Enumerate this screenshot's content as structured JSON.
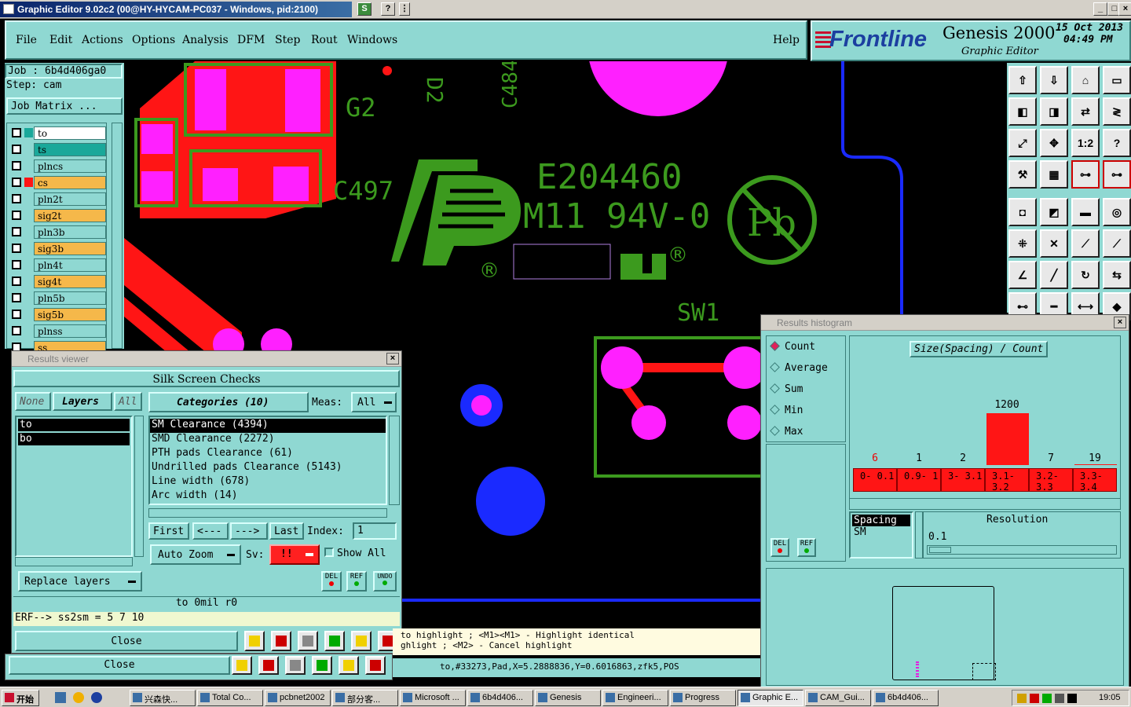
{
  "window": {
    "title": "Graphic Editor 9.02c2 (00@HY-HYCAM-PC037 - Windows, pid:2100)"
  },
  "menu": {
    "items": [
      "File",
      "Edit",
      "Actions",
      "Options",
      "Analysis",
      "DFM",
      "Step",
      "Rout",
      "Windows"
    ],
    "help": "Help"
  },
  "brand": {
    "logo": "Frontline",
    "product": "Genesis 2000",
    "subtitle": "Graphic Editor",
    "date": "15 Oct 2013",
    "time": "04:49 PM"
  },
  "job": {
    "job_line": "Job : 6b4d406ga0",
    "step_line": "Step: cam",
    "matrix_button": "Job Matrix ..."
  },
  "layers": [
    {
      "name": "to",
      "color": "#ffffff"
    },
    {
      "name": "ts",
      "color": "#1aa89a"
    },
    {
      "name": "plncs",
      "color": "#8fd8d2"
    },
    {
      "name": "cs",
      "color": "#f5b84a"
    },
    {
      "name": "pln2t",
      "color": "#8fd8d2"
    },
    {
      "name": "sig2t",
      "color": "#f5b84a"
    },
    {
      "name": "pln3b",
      "color": "#8fd8d2"
    },
    {
      "name": "sig3b",
      "color": "#f5b84a"
    },
    {
      "name": "pln4t",
      "color": "#8fd8d2"
    },
    {
      "name": "sig4t",
      "color": "#f5b84a"
    },
    {
      "name": "pln5b",
      "color": "#8fd8d2"
    },
    {
      "name": "sig5b",
      "color": "#f5b84a"
    },
    {
      "name": "plnss",
      "color": "#8fd8d2"
    },
    {
      "name": "ss",
      "color": "#f5b84a"
    }
  ],
  "canvas": {
    "labels": {
      "g2": "G2",
      "d2": "D2",
      "c484": "C484",
      "c497": "C497",
      "e_code": "E204460",
      "m_code": "M11 94V-0",
      "pb": "Pb",
      "sw1": "SW1",
      "reg1": "®",
      "reg2": "®"
    }
  },
  "results_viewer": {
    "title": "Results viewer",
    "header": "Silk Screen Checks",
    "none_btn": "None",
    "layers_btn": "Layers",
    "all_btn": "All",
    "layers": [
      "to",
      "bo"
    ],
    "categories_btn": "Categories (10)",
    "meas_label": "Meas:",
    "meas_value": "All",
    "categories": [
      "SM Clearance (4394)",
      "SMD Clearance (2272)",
      "PTH pads Clearance (61)",
      "Undrilled pads Clearance (5143)",
      "Line width (678)",
      "Arc width (14)"
    ],
    "nav": {
      "first": "First",
      "prev": "<---",
      "next": "--->",
      "last": "Last",
      "index_label": "Index:",
      "index_value": "1"
    },
    "auto_zoom": "Auto Zoom",
    "sv_label": "Sv:",
    "sv_value": "!!",
    "show_all": "Show All",
    "replace_layers": "Replace layers",
    "del": "DEL",
    "ref": "REF",
    "undo": "UNDO",
    "status1": "to 0mil   r0",
    "status2": "ERF--> ss2sm = 5 7 10",
    "close": "Close"
  },
  "bottom": {
    "close2": "Close",
    "hint1": "to highlight ; <M1><M1> - Highlight identical",
    "hint2": "ghlight ; <M2> - Cancel highlight",
    "coords": "to,#33273,Pad,X=5.2888836,Y=0.6016863,zfk5,POS"
  },
  "histogram": {
    "title": "Results histogram",
    "modes": [
      "Count",
      "Average",
      "Sum",
      "Min",
      "Max"
    ],
    "selected_mode": "Count",
    "chart_title": "Size(Spacing) / Count",
    "bins": [
      "0- 0.1",
      "0.9- 1",
      "3- 3.1",
      "3.1- 3.2",
      "3.2- 3.3",
      "3.3- 3.4"
    ],
    "counts": [
      "6",
      "1",
      "2",
      "1200",
      "7",
      "19"
    ],
    "peak": 1200,
    "list_items": [
      "Spacing",
      "SM"
    ],
    "resolution_label": "Resolution",
    "resolution_value": "0.1",
    "del": "DEL",
    "ref": "REF"
  },
  "taskbar": {
    "start": "开始",
    "tasks": [
      "兴森快...",
      "Total Co...",
      "pcbnet2002",
      "部分客...",
      "Microsoft ...",
      "6b4d406...",
      "Genesis",
      "Engineeri...",
      "Progress",
      "Graphic E...",
      "CAM_Gui...",
      "6b4d406..."
    ],
    "clock": "19:05"
  }
}
